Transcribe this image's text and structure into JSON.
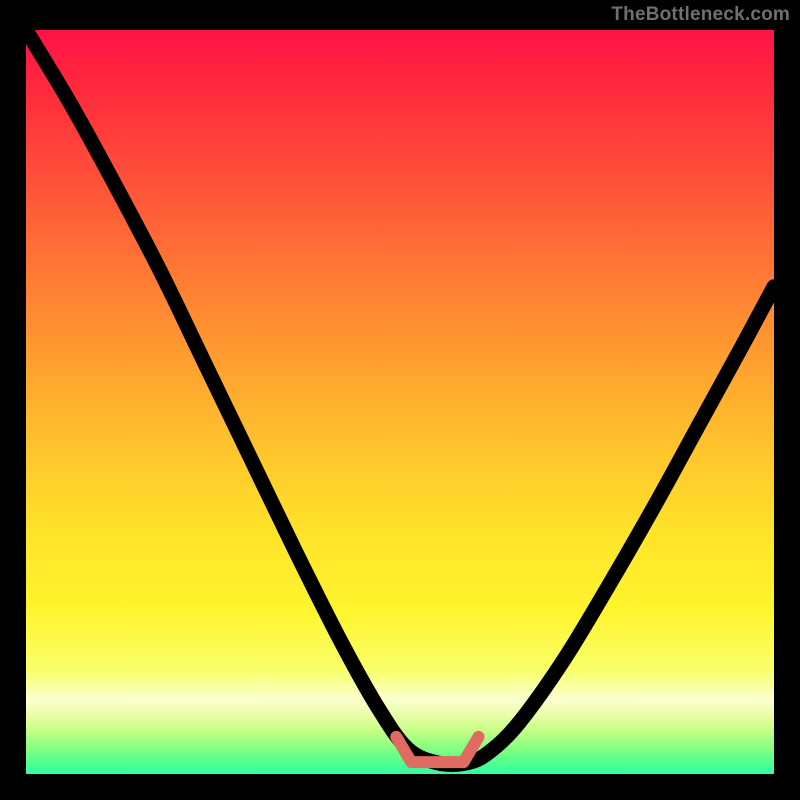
{
  "watermark": {
    "text": "TheBottleneck.com"
  },
  "colors": {
    "curve": "#000000",
    "marker": "#e06b62",
    "top_gradient": "#ff1345",
    "bottom_gradient": "#2effa0"
  },
  "chart_data": {
    "type": "line",
    "title": "",
    "xlabel": "",
    "ylabel": "",
    "xlim": [
      0,
      100
    ],
    "ylim": [
      0,
      100
    ],
    "grid": false,
    "legend": false,
    "series": [
      {
        "name": "bottleneck-curve",
        "x": [
          0,
          6,
          12,
          18,
          24,
          30,
          36,
          42,
          47,
          51,
          55,
          59,
          62,
          66,
          72,
          78,
          84,
          90,
          96,
          100
        ],
        "values": [
          100,
          90,
          79,
          67.5,
          55,
          42.5,
          30,
          18,
          9,
          3.4,
          1.5,
          1.5,
          3,
          7,
          15.5,
          25.5,
          36,
          47,
          58,
          65.5
        ]
      }
    ],
    "annotations": [
      {
        "name": "optimal-flat-segment",
        "shape": "polyline",
        "points_x": [
          49.5,
          51.5,
          58.5,
          60.5
        ],
        "points_y": [
          5.0,
          1.6,
          1.6,
          5.0
        ]
      }
    ]
  }
}
